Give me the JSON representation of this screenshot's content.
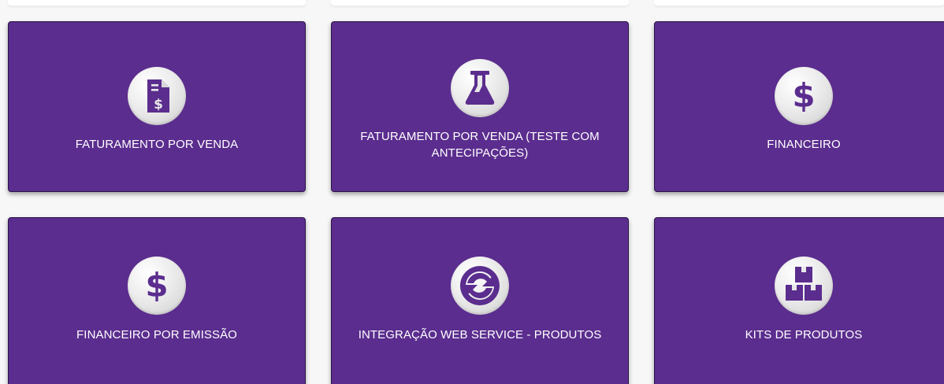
{
  "colors": {
    "card_background": "#5b2d8e",
    "icon_color": "#5b2d8e",
    "icon_circle": "#e8e8e8",
    "label_color": "#ffffff",
    "page_background": "#f7f7f8"
  },
  "cards": [
    {
      "label": "FATURAMENTO POR VENDA",
      "icon": "invoice-dollar-icon"
    },
    {
      "label": "FATURAMENTO POR VENDA (TESTE COM ANTECIPAÇÕES)",
      "icon": "flask-icon"
    },
    {
      "label": "FINANCEIRO",
      "icon": "dollar-icon"
    },
    {
      "label": "FINANCEIRO POR EMISSÃO",
      "icon": "dollar-icon"
    },
    {
      "label": "INTEGRAÇÃO WEB SERVICE - PRODUTOS",
      "icon": "sync-icon"
    },
    {
      "label": "KITS DE PRODUTOS",
      "icon": "boxes-icon"
    }
  ]
}
